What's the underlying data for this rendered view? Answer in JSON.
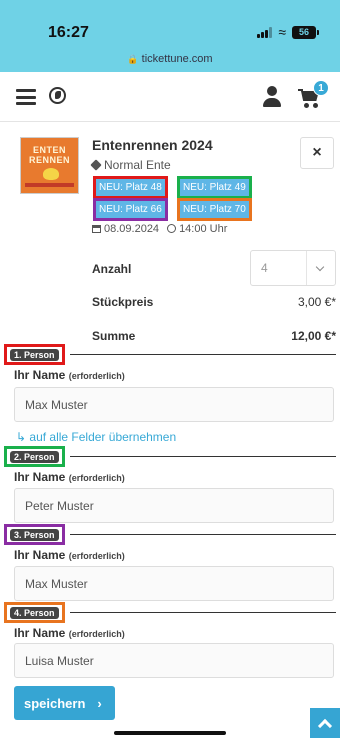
{
  "status_bar": {
    "time": "16:27",
    "battery": "56"
  },
  "browser": {
    "url": "tickettune.com"
  },
  "header": {
    "cart_count": "1"
  },
  "product": {
    "title": "Entenrennen 2024",
    "variant": "Normal Ente",
    "thumb_text": "ENTEN RENNEN",
    "seats": [
      "NEU: Platz 48",
      "NEU: Platz 49",
      "NEU: Platz 66",
      "NEU: Platz 70"
    ],
    "date": "08.09.2024",
    "time": "14:00 Uhr",
    "close_label": "×"
  },
  "order": {
    "quantity_label": "Anzahl",
    "quantity_value": "4",
    "unit_price_label": "Stückpreis",
    "unit_price": "3,00 €*",
    "sum_label": "Summe",
    "sum": "12,00 €*"
  },
  "persons": [
    {
      "badge": "1. Person",
      "label": "Ihr Name",
      "required": "(erforderlich)",
      "value": "Max Muster"
    },
    {
      "badge": "2. Person",
      "label": "Ihr Name",
      "required": "(erforderlich)",
      "value": "Peter Muster"
    },
    {
      "badge": "3. Person",
      "label": "Ihr Name",
      "required": "(erforderlich)",
      "value": "Max Muster"
    },
    {
      "badge": "4. Person",
      "label": "Ihr Name",
      "required": "(erforderlich)",
      "value": "Luisa Muster"
    }
  ],
  "copy_all_label": "↳ auf alle Felder übernehmen",
  "save": {
    "label": "speichern",
    "arrow": "›"
  },
  "colors": {
    "accent": "#36a5d3",
    "topbar": "#6fd2e6",
    "mark_red": "#e01919",
    "mark_green": "#1ab04b",
    "mark_purple": "#8a2da3",
    "mark_orange": "#e8741f"
  }
}
